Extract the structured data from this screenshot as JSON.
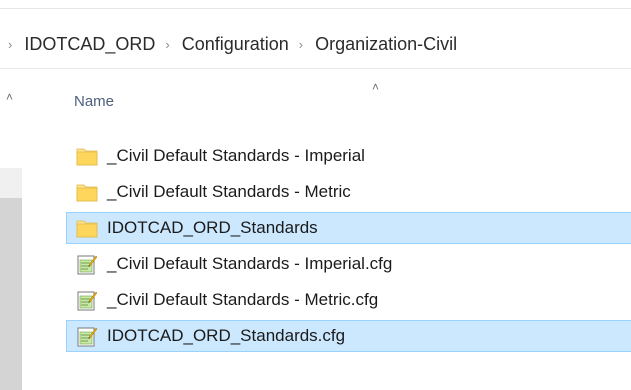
{
  "breadcrumb": {
    "separator": "›",
    "items": [
      "IDOTCAD_ORD",
      "Configuration",
      "Organization-Civil"
    ]
  },
  "column_header": {
    "name_label": "Name"
  },
  "files": [
    {
      "name": "_Civil Default Standards - Imperial",
      "type": "folder",
      "selected": false
    },
    {
      "name": "_Civil Default Standards - Metric",
      "type": "folder",
      "selected": false
    },
    {
      "name": "IDOTCAD_ORD_Standards",
      "type": "folder",
      "selected": true
    },
    {
      "name": "_Civil Default Standards - Imperial.cfg",
      "type": "cfg-file",
      "selected": false
    },
    {
      "name": "_Civil Default Standards - Metric.cfg",
      "type": "cfg-file",
      "selected": false
    },
    {
      "name": "IDOTCAD_ORD_Standards.cfg",
      "type": "cfg-file",
      "selected": true
    }
  ],
  "icons": {
    "folder": "folder-icon",
    "cfg-file": "config-file-icon",
    "sort": "sort-up-icon",
    "scroll_up": "scroll-up-icon"
  },
  "colors": {
    "selection_bg": "#cce8ff",
    "selection_border": "#99d1ff",
    "folder_yellow": "#ffe38f",
    "header_text": "#4c607a"
  }
}
